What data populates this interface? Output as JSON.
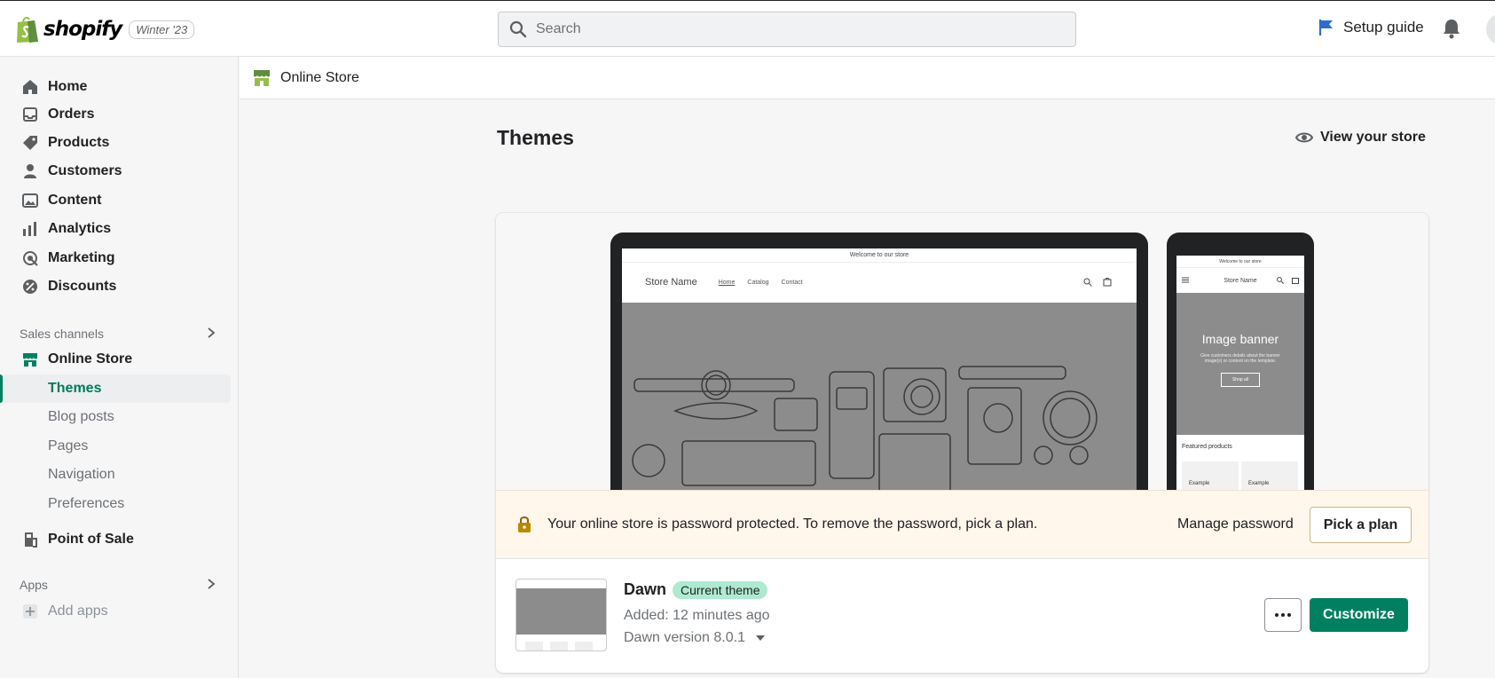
{
  "brand": {
    "name": "shopify",
    "edition": "Winter '23"
  },
  "search": {
    "placeholder": "Search"
  },
  "topbar": {
    "setup_label": "Setup guide"
  },
  "sidebar": {
    "items": [
      {
        "label": "Home",
        "icon": "home-icon"
      },
      {
        "label": "Orders",
        "icon": "inbox-icon"
      },
      {
        "label": "Products",
        "icon": "tag-icon"
      },
      {
        "label": "Customers",
        "icon": "person-icon"
      },
      {
        "label": "Content",
        "icon": "image-icon"
      },
      {
        "label": "Analytics",
        "icon": "bar-chart-icon"
      },
      {
        "label": "Marketing",
        "icon": "target-icon"
      },
      {
        "label": "Discounts",
        "icon": "discount-icon"
      }
    ],
    "sales_channels_label": "Sales channels",
    "online_store": "Online Store",
    "sub_items": [
      "Themes",
      "Blog posts",
      "Pages",
      "Navigation",
      "Preferences"
    ],
    "point_of_sale": "Point of Sale",
    "apps_label": "Apps",
    "add_apps": "Add apps"
  },
  "breadcrumb": {
    "label": "Online Store"
  },
  "page": {
    "title": "Themes",
    "view_store": "View your store"
  },
  "preview": {
    "desktop": {
      "announcement": "Welcome to our store",
      "store_name": "Store Name",
      "nav": [
        "Home",
        "Catalog",
        "Contact"
      ]
    },
    "mobile": {
      "announcement": "Welcome to our store",
      "store_name": "Store Name",
      "banner_title": "Image banner",
      "banner_subtitle": "Give customers details about the banner image(s) or content on the template.",
      "shop_all": "Shop all",
      "featured": "Featured products",
      "products": [
        "Example",
        "Example"
      ]
    }
  },
  "password_banner": {
    "text": "Your online store is password protected. To remove the password, pick a plan.",
    "manage": "Manage password",
    "pick_plan": "Pick a plan"
  },
  "theme": {
    "name": "Dawn",
    "badge": "Current theme",
    "added": "Added: 12 minutes ago",
    "version": "Dawn version 8.0.1",
    "customize": "Customize"
  },
  "colors": {
    "accent": "#008060",
    "badge": "#aee9d1",
    "banner_bg": "#fff6ec"
  }
}
